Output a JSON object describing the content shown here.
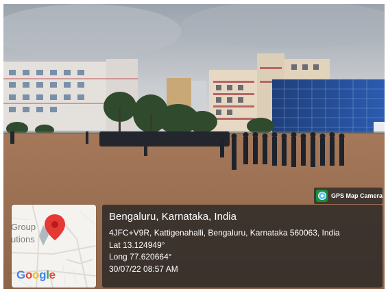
{
  "badge": {
    "label": "GPS Map Camera",
    "icon": "gps-map-camera-icon"
  },
  "map": {
    "label_line1": "Group",
    "label_line2": "utions",
    "google_letters": [
      "G",
      "o",
      "o",
      "g",
      "l",
      "e"
    ],
    "pin_color": "#e53935"
  },
  "info": {
    "title": "Bengaluru, Karnataka, India",
    "address": "4JFC+V9R, Kattigenahalli, Bengaluru, Karnataka 560063, India",
    "lat": "Lat 13.124949°",
    "long": "Long 77.620664°",
    "datetime": "30/07/22 08:57 AM"
  }
}
